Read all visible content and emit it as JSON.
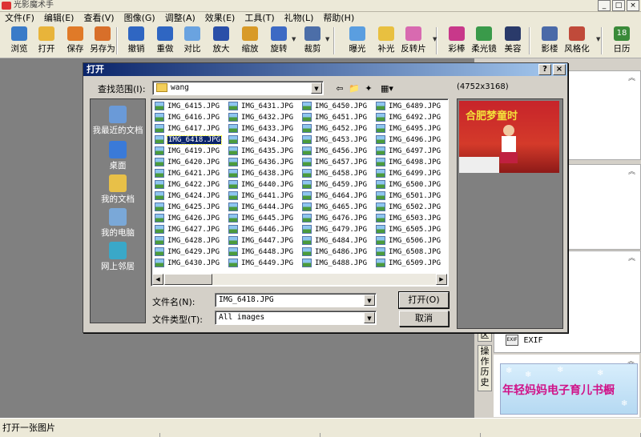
{
  "app": {
    "title": "光影魔术手"
  },
  "window_controls": [
    "_",
    "□",
    "×"
  ],
  "menu": [
    "文件(F)",
    "编辑(E)",
    "查看(V)",
    "图像(G)",
    "调整(A)",
    "效果(E)",
    "工具(T)",
    "礼物(L)",
    "帮助(H)"
  ],
  "toolbar": [
    {
      "label": "浏览",
      "icon": "browse-icon",
      "color": "#3a7bc8"
    },
    {
      "label": "打开",
      "icon": "open-folder-icon",
      "color": "#e8b43a"
    },
    {
      "label": "保存",
      "icon": "save-disk-icon",
      "color": "#e07a28"
    },
    {
      "label": "另存为",
      "icon": "save-as-icon",
      "color": "#d86f2a"
    },
    {
      "label": "撤销",
      "icon": "undo-icon",
      "color": "#2f66c2"
    },
    {
      "label": "重做",
      "icon": "redo-icon",
      "color": "#2f66c2"
    },
    {
      "label": "对比",
      "icon": "compare-icon",
      "color": "#6aa3e0"
    },
    {
      "label": "放大",
      "icon": "zoom-in-icon",
      "color": "#2a4fa8"
    },
    {
      "label": "缩放",
      "icon": "resize-icon",
      "color": "#d89a28"
    },
    {
      "label": "旋转",
      "icon": "rotate-icon",
      "color": "#3d6ac4"
    },
    {
      "label": "裁剪",
      "icon": "crop-icon",
      "color": "#4c6ea8"
    },
    {
      "label": "曝光",
      "icon": "exposure-icon",
      "color": "#5a9ee0"
    },
    {
      "label": "补光",
      "icon": "fill-light-icon",
      "color": "#e8c040"
    },
    {
      "label": "反转片",
      "icon": "reversal-film-icon",
      "color": "#d86ab0"
    },
    {
      "label": "彩棒",
      "icon": "color-wand-icon",
      "color": "#c8388a"
    },
    {
      "label": "柔光镜",
      "icon": "soft-lens-icon",
      "color": "#3a9a4a"
    },
    {
      "label": "美容",
      "icon": "beauty-icon",
      "color": "#2a3a6a"
    },
    {
      "label": "影楼",
      "icon": "studio-icon",
      "color": "#4a6aa8"
    },
    {
      "label": "风格化",
      "icon": "stylize-icon",
      "color": "#c04a3a"
    },
    {
      "label": "日历",
      "icon": "calendar-icon",
      "color": "#3a8a3a",
      "badge": "18"
    }
  ],
  "dialog": {
    "title": "打开",
    "help_btn": "?",
    "close_btn": "×",
    "look_in_label": "查找范围(I):",
    "look_in_value": "wang",
    "preview_size": "(4752x3168)",
    "places": [
      {
        "label": "我最近的文档",
        "icon": "recent-docs-icon",
        "color": "#6a9ad8"
      },
      {
        "label": "桌面",
        "icon": "desktop-icon",
        "color": "#3a7ad8"
      },
      {
        "label": "我的文档",
        "icon": "my-documents-icon",
        "color": "#e8c048"
      },
      {
        "label": "我的电脑",
        "icon": "my-computer-icon",
        "color": "#7aa8d8"
      },
      {
        "label": "网上邻居",
        "icon": "network-places-icon",
        "color": "#3aa8c8"
      }
    ],
    "files": [
      [
        "IMG_6415.JPG",
        "IMG_6416.JPG",
        "IMG_6417.JPG",
        "IMG_6418.JPG",
        "IMG_6419.JPG",
        "IMG_6420.JPG",
        "IMG_6421.JPG",
        "IMG_6422.JPG",
        "IMG_6424.JPG",
        "IMG_6425.JPG",
        "IMG_6426.JPG",
        "IMG_6427.JPG",
        "IMG_6428.JPG",
        "IMG_6429.JPG",
        "IMG_6430.JPG"
      ],
      [
        "IMG_6431.JPG",
        "IMG_6432.JPG",
        "IMG_6433.JPG",
        "IMG_6434.JPG",
        "IMG_6435.JPG",
        "IMG_6436.JPG",
        "IMG_6438.JPG",
        "IMG_6440.JPG",
        "IMG_6441.JPG",
        "IMG_6444.JPG",
        "IMG_6445.JPG",
        "IMG_6446.JPG",
        "IMG_6447.JPG",
        "IMG_6448.JPG",
        "IMG_6449.JPG"
      ],
      [
        "IMG_6450.JPG",
        "IMG_6451.JPG",
        "IMG_6452.JPG",
        "IMG_6453.JPG",
        "IMG_6456.JPG",
        "IMG_6457.JPG",
        "IMG_6458.JPG",
        "IMG_6459.JPG",
        "IMG_6464.JPG",
        "IMG_6465.JPG",
        "IMG_6476.JPG",
        "IMG_6479.JPG",
        "IMG_6484.JPG",
        "IMG_6486.JPG",
        "IMG_6488.JPG"
      ],
      [
        "IMG_6489.JPG",
        "IMG_6492.JPG",
        "IMG_6495.JPG",
        "IMG_6496.JPG",
        "IMG_6497.JPG",
        "IMG_6498.JPG",
        "IMG_6499.JPG",
        "IMG_6500.JPG",
        "IMG_6501.JPG",
        "IMG_6502.JPG",
        "IMG_6503.JPG",
        "IMG_6505.JPG",
        "IMG_6506.JPG",
        "IMG_6508.JPG",
        "IMG_6509.JPG"
      ]
    ],
    "selected_file": "IMG_6418.JPG",
    "filename_label": "文件名(N):",
    "filename_value": "IMG_6418.JPG",
    "filetype_label": "文件类型(T):",
    "filetype_value": "All images",
    "open_button": "打开(O)",
    "cancel_button": "取消",
    "preview_text": "合肥梦童时"
  },
  "right_panel": {
    "vtab_top": "区",
    "vtab_label": "操作历史",
    "exif_label": "EXIF",
    "exif_icon_text": "EXIF",
    "chevron": "︽",
    "banner_text": "年轻妈妈电子育儿书橱"
  },
  "status": {
    "text": "打开一张图片"
  }
}
